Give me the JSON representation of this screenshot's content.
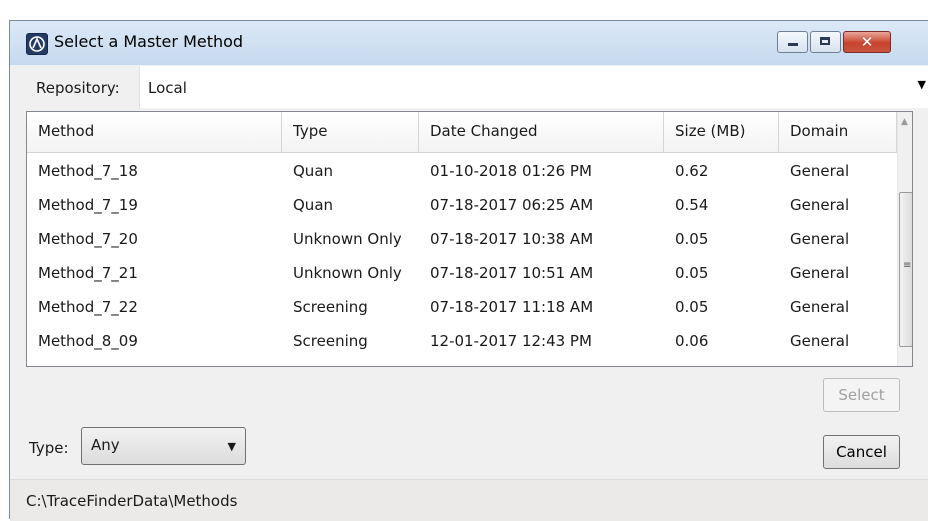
{
  "window": {
    "title": "Select a Master Method",
    "icon": "thermo-logo-icon",
    "controls": {
      "minimize": "minimize-icon",
      "maximize": "maximize-icon",
      "close_glyph": "✕"
    }
  },
  "repository": {
    "label": "Repository:",
    "value": "Local"
  },
  "table": {
    "columns": [
      "Method",
      "Type",
      "Date Changed",
      "Size (MB)",
      "Domain"
    ],
    "rows": [
      [
        "Method_7_18",
        "Quan",
        "01-10-2018 01:26 PM",
        "0.62",
        "General"
      ],
      [
        "Method_7_19",
        "Quan",
        "07-18-2017 06:25 AM",
        "0.54",
        "General"
      ],
      [
        "Method_7_20",
        "Unknown Only",
        "07-18-2017 10:38 AM",
        "0.05",
        "General"
      ],
      [
        "Method_7_21",
        "Unknown Only",
        "07-18-2017 10:51 AM",
        "0.05",
        "General"
      ],
      [
        "Method_7_22",
        "Screening",
        "07-18-2017 11:18 AM",
        "0.05",
        "General"
      ],
      [
        "Method_8_09",
        "Screening",
        "12-01-2017 12:43 PM",
        "0.06",
        "General"
      ]
    ]
  },
  "buttons": {
    "select": "Select",
    "cancel": "Cancel"
  },
  "type_filter": {
    "label": "Type:",
    "value": "Any"
  },
  "status": {
    "path": "C:\\TraceFinderData\\Methods"
  },
  "colors": {
    "titlebar": "#c5d9ee",
    "close": "#c7432d",
    "disabled_text": "#a0a0a0"
  }
}
